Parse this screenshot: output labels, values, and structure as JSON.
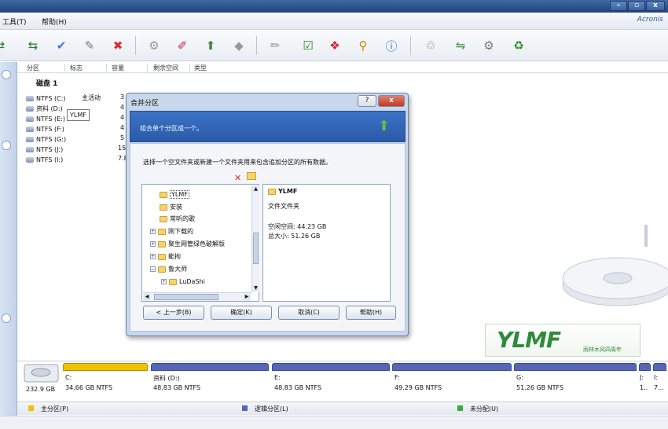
{
  "menu": {
    "tools": "工具(T)",
    "help": "帮助(H)",
    "brand": "Acronis"
  },
  "window_buttons": {
    "minimize": "–",
    "maximize": "▫",
    "close": "x"
  },
  "toolbar": {
    "icons": [
      "arrows-icon",
      "arrows-icon",
      "check-disk-icon",
      "wrench-disk-icon",
      "remove-disk-icon",
      "copy-disk-icon",
      "edit-disk-icon",
      "merge-disk-icon",
      "split-disk-icon",
      "erase-disk-icon",
      "commit-icon",
      "package-icon",
      "search-icon",
      "info-icon",
      "disk-recycle-icon",
      "disk-arrows-icon",
      "disk-gear-icon",
      "recycle-icon"
    ]
  },
  "columns": [
    "分区",
    "标志",
    "容量",
    "剩余空间",
    "类型"
  ],
  "disk1": {
    "label": "磁盘 1",
    "rows": [
      {
        "name": "NTFS (C:)",
        "flag": "主活动",
        "cap": "3"
      },
      {
        "name": "资料 (D:)",
        "flag": "",
        "cap": "4"
      },
      {
        "name": "NTFS (E:)",
        "flag": "",
        "cap": "4"
      },
      {
        "name": "NTFS (F:)",
        "flag": "",
        "cap": "4"
      },
      {
        "name": "NTFS (G:)",
        "flag": "",
        "cap": "5"
      },
      {
        "name": "NTFS (J:)",
        "flag": "",
        "cap": "15"
      },
      {
        "name": "NTFS (I:)",
        "flag": "",
        "cap": "7.8"
      }
    ]
  },
  "dialog": {
    "title": "合并分区",
    "help_btn": "?",
    "close_btn": "x",
    "banner": "组合单个分区成一个。",
    "instruction": "选择一个空文件夹或新建一个文件夹用来包含追加分区的所有数据。",
    "tree": [
      {
        "label": "YLMF",
        "indent": 0,
        "expander": ""
      },
      {
        "label": "安装",
        "indent": 0,
        "expander": ""
      },
      {
        "label": "常听的歌",
        "indent": 0,
        "expander": ""
      },
      {
        "label": "刚下载的",
        "indent": 0,
        "expander": "+"
      },
      {
        "label": "聚生网管绿色破解版",
        "indent": 0,
        "expander": "+"
      },
      {
        "label": "能拘",
        "indent": 0,
        "expander": "+"
      },
      {
        "label": "鲁大师",
        "indent": 0,
        "expander": "−"
      },
      {
        "label": "LuDaShi",
        "indent": 1,
        "expander": "+"
      }
    ],
    "tooltip": "YLMF",
    "info": {
      "name": "YLMF",
      "type": "文件文件夹",
      "free": "空闲空间: 44.23 GB",
      "total": "总大小: 51.26 GB"
    },
    "buttons": {
      "back": "< 上一步(B)",
      "ok": "确定(K)",
      "cancel": "取消(C)",
      "help": "帮助(H)"
    }
  },
  "logo": {
    "text": "YLMF",
    "caption": "雨林木风四周年"
  },
  "disk_map": {
    "size": "232.9 GB",
    "parts": [
      {
        "letter": "C:",
        "size": "34.66 GB  NTFS",
        "color": "#f2c200"
      },
      {
        "letter": "资料 (D:)",
        "size": "48.83 GB  NTFS",
        "color": "#5566b8"
      },
      {
        "letter": "E:",
        "size": "48.83 GB  NTFS",
        "color": "#5566b8"
      },
      {
        "letter": "F:",
        "size": "49.29 GB  NTFS",
        "color": "#5566b8"
      },
      {
        "letter": "G:",
        "size": "51.26 GB  NTFS",
        "color": "#5566b8"
      },
      {
        "letter": "J:",
        "size": "1..",
        "color": "#5566b8"
      },
      {
        "letter": "I:",
        "size": "7...",
        "color": "#5566b8"
      }
    ]
  },
  "legend": {
    "primary": "主分区(P)",
    "logical": "逻辑分区(L)",
    "unallocated": "未分配(U)",
    "colors": {
      "primary": "#f2c200",
      "logical": "#5566b8",
      "unallocated": "#3caa3c"
    }
  }
}
